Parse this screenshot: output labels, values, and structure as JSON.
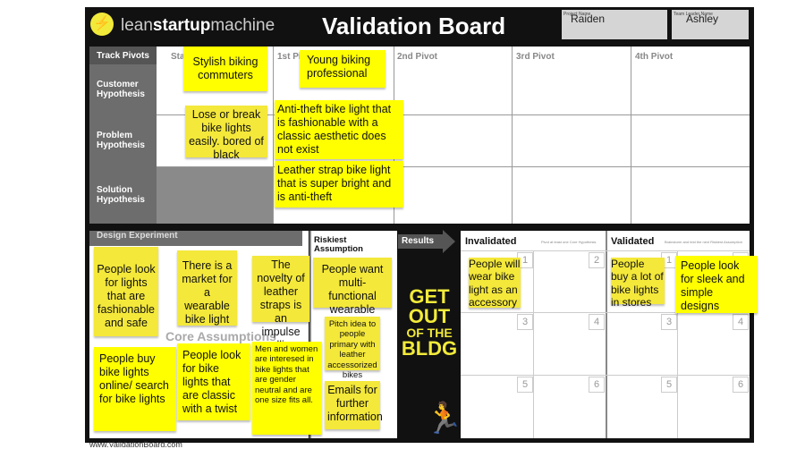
{
  "header": {
    "logo_text_pre": "lean",
    "logo_text_bold": "startup",
    "logo_text_post": "machine",
    "title": "Validation Board",
    "project_name_label": "Project Name",
    "project_name": "Raiden",
    "team_leader_label": "Team Leader Name",
    "team_leader": "Ashley"
  },
  "pivots": {
    "track_label": "Track Pivots",
    "columns": [
      "Start",
      "1st Pivot",
      "2nd Pivot",
      "3rd Pivot",
      "4th Pivot"
    ],
    "rows": [
      "Customer Hypothesis",
      "Problem Hypothesis",
      "Solution Hypothesis"
    ]
  },
  "top_notes": [
    "Stylish biking commuters",
    "Young biking professional",
    "Lose or break bike lights easily. bored of black",
    "Anti-theft bike light that is fashionable with a classic aesthetic does not exist",
    "Leather strap bike light that is super bright and is anti-theft"
  ],
  "experiment": {
    "title": "Design Experiment",
    "core_assumptions": "Core Assumptions",
    "riskiest": "Riskiest Assumption",
    "notes": [
      "People look for lights that are fashionable and safe",
      "There is a market for a wearable bike light",
      "The novelty of leather straps is an impulse selling point",
      "People want multi-functional wearable lights",
      "People buy bike lights online/ search for bike lights",
      "People look for bike lights that are classic with a twist",
      "Men and women are interesed in bike lights that are  gender neutral and are one size fits all.",
      "Pitch idea to people primary with leather accessorized bikes",
      "Emails for further information"
    ]
  },
  "results": {
    "label": "Results",
    "get_out": [
      "GET",
      "OUT",
      "OF THE",
      "BLDG"
    ],
    "invalidated": "Invalidated",
    "validated": "Validated",
    "invalidated_hint": "Pivot at least one Core Hypothesis",
    "validated_hint": "Brainstorm and test the next Riskiest Assumption",
    "numbers": [
      "1",
      "2",
      "3",
      "4",
      "5",
      "6"
    ],
    "notes": [
      "People will wear bike light as an accessory",
      "People buy a lot of bike lights in stores",
      "People look for sleek and simple designs"
    ]
  },
  "footer": {
    "url": "www.ValidationBoard.com"
  },
  "colors": {
    "sticky": "#ffff00",
    "board": "#111111",
    "accent_text": "#f2ea3a",
    "label_gray": "#6d6d6d"
  }
}
